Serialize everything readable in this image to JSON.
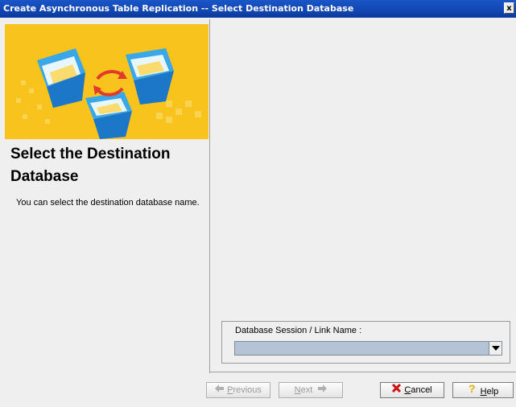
{
  "window": {
    "title": "Create Asynchronous Table Replication -- Select Destination Database",
    "close_glyph": "x"
  },
  "left": {
    "step_title": "Select the Destination Database",
    "step_description": "You can select the destination database name."
  },
  "form": {
    "field_label": "Database Session / Link Name :",
    "field_value": ""
  },
  "buttons": {
    "previous": {
      "label": "Previous",
      "mnemonic": "P",
      "rest": "revious",
      "icon": "arrow-left-icon"
    },
    "next": {
      "label": "Next",
      "mnemonic": "N",
      "rest": "ext",
      "icon": "arrow-right-icon"
    },
    "cancel": {
      "label": "Cancel",
      "mnemonic": "C",
      "rest": "ancel",
      "icon": "red-x-icon"
    },
    "help": {
      "label": "Help",
      "mnemonic": "H",
      "rest": "elp",
      "icon": "question-mark-icon"
    }
  },
  "colors": {
    "titlebar": "#0b3aa0",
    "banner": "#f7c21a",
    "combo_fill": "#b5c3d6",
    "cancel_icon": "#d01010",
    "help_icon": "#e0b000"
  }
}
